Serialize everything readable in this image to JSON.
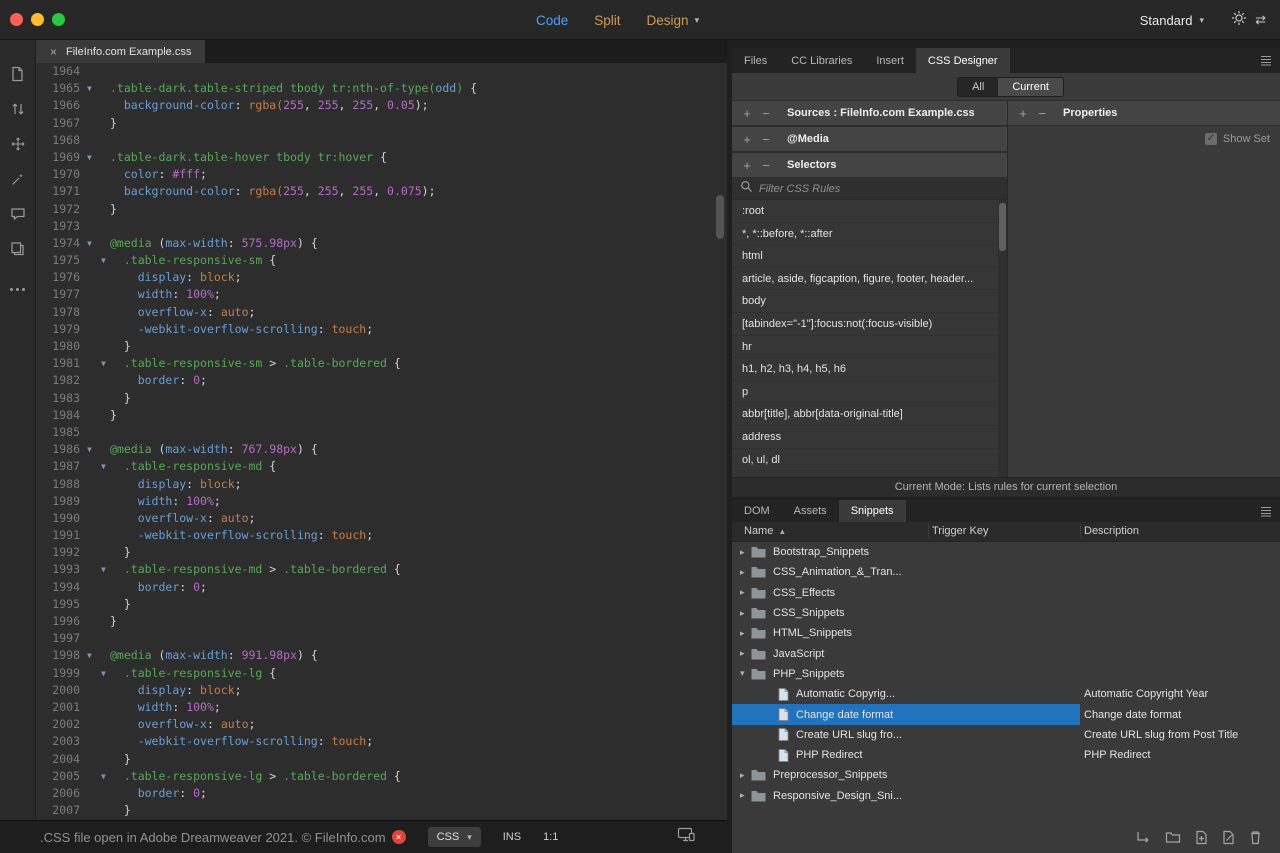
{
  "topbar": {
    "view_modes": [
      {
        "label": "Code",
        "active": true
      },
      {
        "label": "Split",
        "active": false
      },
      {
        "label": "Design",
        "active": false
      }
    ],
    "workspace": {
      "label": "Standard"
    }
  },
  "editor": {
    "tab": {
      "title": "FileInfo.com Example.css",
      "close_glyph": "×"
    },
    "status": {
      "message": ".CSS file open in Adobe Dreamweaver 2021. © FileInfo.com",
      "doc_type": "CSS",
      "insert_mode": "INS",
      "cursor_position": "1:1"
    },
    "lines": [
      {
        "n": 1964,
        "f": 0,
        "k": []
      },
      {
        "n": 1965,
        "f": 1,
        "k": [
          [
            ".table-dark.table-striped tbody tr:nth-of-type(",
            "s"
          ],
          [
            "odd",
            "p"
          ],
          [
            ")",
            "s"
          ],
          [
            " {",
            "w"
          ]
        ]
      },
      {
        "n": 1966,
        "f": 0,
        "k": [
          [
            "  ",
            "w"
          ],
          [
            "background-color",
            "p"
          ],
          [
            ": ",
            "w"
          ],
          [
            "rgba(",
            "v"
          ],
          [
            "255",
            "n"
          ],
          [
            ", ",
            "w"
          ],
          [
            "255",
            "n"
          ],
          [
            ", ",
            "w"
          ],
          [
            "255",
            "n"
          ],
          [
            ", ",
            "w"
          ],
          [
            "0.05",
            "n"
          ],
          [
            ");",
            "w"
          ]
        ]
      },
      {
        "n": 1967,
        "f": 0,
        "k": [
          [
            "}",
            "w"
          ]
        ]
      },
      {
        "n": 1968,
        "f": 0,
        "k": []
      },
      {
        "n": 1969,
        "f": 1,
        "k": [
          [
            ".table-dark.table-hover tbody tr:hover",
            "s"
          ],
          [
            " {",
            "w"
          ]
        ]
      },
      {
        "n": 1970,
        "f": 0,
        "k": [
          [
            "  ",
            "w"
          ],
          [
            "color",
            "p"
          ],
          [
            ": ",
            "w"
          ],
          [
            "#fff",
            "n"
          ],
          [
            ";",
            "w"
          ]
        ]
      },
      {
        "n": 1971,
        "f": 0,
        "k": [
          [
            "  ",
            "w"
          ],
          [
            "background-color",
            "p"
          ],
          [
            ": ",
            "w"
          ],
          [
            "rgba(",
            "v"
          ],
          [
            "255",
            "n"
          ],
          [
            ", ",
            "w"
          ],
          [
            "255",
            "n"
          ],
          [
            ", ",
            "w"
          ],
          [
            "255",
            "n"
          ],
          [
            ", ",
            "w"
          ],
          [
            "0.075",
            "n"
          ],
          [
            ");",
            "w"
          ]
        ]
      },
      {
        "n": 1972,
        "f": 0,
        "k": [
          [
            "}",
            "w"
          ]
        ]
      },
      {
        "n": 1973,
        "f": 0,
        "k": []
      },
      {
        "n": 1974,
        "f": 1,
        "k": [
          [
            "@media ",
            "s"
          ],
          [
            "(",
            "w"
          ],
          [
            "max-width",
            "p"
          ],
          [
            ": ",
            "w"
          ],
          [
            "575.98px",
            "n"
          ],
          [
            ") {",
            "w"
          ]
        ]
      },
      {
        "n": 1975,
        "f": 1,
        "k": [
          [
            "  ",
            "w"
          ],
          [
            ".table-responsive-sm",
            "s"
          ],
          [
            " {",
            "w"
          ]
        ]
      },
      {
        "n": 1976,
        "f": 0,
        "k": [
          [
            "    ",
            "w"
          ],
          [
            "display",
            "p"
          ],
          [
            ": ",
            "w"
          ],
          [
            "block",
            "v"
          ],
          [
            ";",
            "w"
          ]
        ]
      },
      {
        "n": 1977,
        "f": 0,
        "k": [
          [
            "    ",
            "w"
          ],
          [
            "width",
            "p"
          ],
          [
            ": ",
            "w"
          ],
          [
            "100%",
            "n"
          ],
          [
            ";",
            "w"
          ]
        ]
      },
      {
        "n": 1978,
        "f": 0,
        "k": [
          [
            "    ",
            "w"
          ],
          [
            "overflow-x",
            "p"
          ],
          [
            ": ",
            "w"
          ],
          [
            "auto",
            "v"
          ],
          [
            ";",
            "w"
          ]
        ]
      },
      {
        "n": 1979,
        "f": 0,
        "k": [
          [
            "    ",
            "w"
          ],
          [
            "-webkit-overflow-scrolling",
            "p"
          ],
          [
            ": ",
            "w"
          ],
          [
            "touch",
            "v"
          ],
          [
            ";",
            "w"
          ]
        ]
      },
      {
        "n": 1980,
        "f": 0,
        "k": [
          [
            "  }",
            "w"
          ]
        ]
      },
      {
        "n": 1981,
        "f": 1,
        "k": [
          [
            "  ",
            "w"
          ],
          [
            ".table-responsive-sm ",
            "s"
          ],
          [
            "> ",
            "w"
          ],
          [
            ".table-bordered",
            "s"
          ],
          [
            " {",
            "w"
          ]
        ]
      },
      {
        "n": 1982,
        "f": 0,
        "k": [
          [
            "    ",
            "w"
          ],
          [
            "border",
            "p"
          ],
          [
            ": ",
            "w"
          ],
          [
            "0",
            "n"
          ],
          [
            ";",
            "w"
          ]
        ]
      },
      {
        "n": 1983,
        "f": 0,
        "k": [
          [
            "  }",
            "w"
          ]
        ]
      },
      {
        "n": 1984,
        "f": 0,
        "k": [
          [
            "}",
            "w"
          ]
        ]
      },
      {
        "n": 1985,
        "f": 0,
        "k": []
      },
      {
        "n": 1986,
        "f": 1,
        "k": [
          [
            "@media ",
            "s"
          ],
          [
            "(",
            "w"
          ],
          [
            "max-width",
            "p"
          ],
          [
            ": ",
            "w"
          ],
          [
            "767.98px",
            "n"
          ],
          [
            ") {",
            "w"
          ]
        ]
      },
      {
        "n": 1987,
        "f": 1,
        "k": [
          [
            "  ",
            "w"
          ],
          [
            ".table-responsive-md",
            "s"
          ],
          [
            " {",
            "w"
          ]
        ]
      },
      {
        "n": 1988,
        "f": 0,
        "k": [
          [
            "    ",
            "w"
          ],
          [
            "display",
            "p"
          ],
          [
            ": ",
            "w"
          ],
          [
            "block",
            "v"
          ],
          [
            ";",
            "w"
          ]
        ]
      },
      {
        "n": 1989,
        "f": 0,
        "k": [
          [
            "    ",
            "w"
          ],
          [
            "width",
            "p"
          ],
          [
            ": ",
            "w"
          ],
          [
            "100%",
            "n"
          ],
          [
            ";",
            "w"
          ]
        ]
      },
      {
        "n": 1990,
        "f": 0,
        "k": [
          [
            "    ",
            "w"
          ],
          [
            "overflow-x",
            "p"
          ],
          [
            ": ",
            "w"
          ],
          [
            "auto",
            "v"
          ],
          [
            ";",
            "w"
          ]
        ]
      },
      {
        "n": 1991,
        "f": 0,
        "k": [
          [
            "    ",
            "w"
          ],
          [
            "-webkit-overflow-scrolling",
            "p"
          ],
          [
            ": ",
            "w"
          ],
          [
            "touch",
            "v"
          ],
          [
            ";",
            "w"
          ]
        ]
      },
      {
        "n": 1992,
        "f": 0,
        "k": [
          [
            "  }",
            "w"
          ]
        ]
      },
      {
        "n": 1993,
        "f": 1,
        "k": [
          [
            "  ",
            "w"
          ],
          [
            ".table-responsive-md ",
            "s"
          ],
          [
            "> ",
            "w"
          ],
          [
            ".table-bordered",
            "s"
          ],
          [
            " {",
            "w"
          ]
        ]
      },
      {
        "n": 1994,
        "f": 0,
        "k": [
          [
            "    ",
            "w"
          ],
          [
            "border",
            "p"
          ],
          [
            ": ",
            "w"
          ],
          [
            "0",
            "n"
          ],
          [
            ";",
            "w"
          ]
        ]
      },
      {
        "n": 1995,
        "f": 0,
        "k": [
          [
            "  }",
            "w"
          ]
        ]
      },
      {
        "n": 1996,
        "f": 0,
        "k": [
          [
            "}",
            "w"
          ]
        ]
      },
      {
        "n": 1997,
        "f": 0,
        "k": []
      },
      {
        "n": 1998,
        "f": 1,
        "k": [
          [
            "@media ",
            "s"
          ],
          [
            "(",
            "w"
          ],
          [
            "max-width",
            "p"
          ],
          [
            ": ",
            "w"
          ],
          [
            "991.98px",
            "n"
          ],
          [
            ") {",
            "w"
          ]
        ]
      },
      {
        "n": 1999,
        "f": 1,
        "k": [
          [
            "  ",
            "w"
          ],
          [
            ".table-responsive-lg",
            "s"
          ],
          [
            " {",
            "w"
          ]
        ]
      },
      {
        "n": 2000,
        "f": 0,
        "k": [
          [
            "    ",
            "w"
          ],
          [
            "display",
            "p"
          ],
          [
            ": ",
            "w"
          ],
          [
            "block",
            "v"
          ],
          [
            ";",
            "w"
          ]
        ]
      },
      {
        "n": 2001,
        "f": 0,
        "k": [
          [
            "    ",
            "w"
          ],
          [
            "width",
            "p"
          ],
          [
            ": ",
            "w"
          ],
          [
            "100%",
            "n"
          ],
          [
            ";",
            "w"
          ]
        ]
      },
      {
        "n": 2002,
        "f": 0,
        "k": [
          [
            "    ",
            "w"
          ],
          [
            "overflow-x",
            "p"
          ],
          [
            ": ",
            "w"
          ],
          [
            "auto",
            "v"
          ],
          [
            ";",
            "w"
          ]
        ]
      },
      {
        "n": 2003,
        "f": 0,
        "k": [
          [
            "    ",
            "w"
          ],
          [
            "-webkit-overflow-scrolling",
            "p"
          ],
          [
            ": ",
            "w"
          ],
          [
            "touch",
            "v"
          ],
          [
            ";",
            "w"
          ]
        ]
      },
      {
        "n": 2004,
        "f": 0,
        "k": [
          [
            "  }",
            "w"
          ]
        ]
      },
      {
        "n": 2005,
        "f": 1,
        "k": [
          [
            "  ",
            "w"
          ],
          [
            ".table-responsive-lg ",
            "s"
          ],
          [
            "> ",
            "w"
          ],
          [
            ".table-bordered",
            "s"
          ],
          [
            " {",
            "w"
          ]
        ]
      },
      {
        "n": 2006,
        "f": 0,
        "k": [
          [
            "    ",
            "w"
          ],
          [
            "border",
            "p"
          ],
          [
            ": ",
            "w"
          ],
          [
            "0",
            "n"
          ],
          [
            ";",
            "w"
          ]
        ]
      },
      {
        "n": 2007,
        "f": 0,
        "k": [
          [
            "  }",
            "w"
          ]
        ]
      }
    ]
  },
  "css_designer": {
    "tabs": [
      {
        "label": "Files"
      },
      {
        "label": "CC Libraries"
      },
      {
        "label": "Insert"
      },
      {
        "label": "CSS Designer",
        "active": true
      }
    ],
    "mode_toggle": [
      {
        "label": "All",
        "active": false
      },
      {
        "label": "Current",
        "active": true
      }
    ],
    "sources_header": {
      "label": "Sources : FileInfo.com Example.css"
    },
    "media_header": {
      "label": "@Media"
    },
    "selectors_header": {
      "label": "Selectors"
    },
    "filter_placeholder": "Filter CSS Rules",
    "selectors": [
      ":root",
      "*, *::before, *::after",
      "html",
      "article, aside, figcaption, figure, footer, header...",
      "body",
      "[tabindex=\"-1\"]:focus:not(:focus-visible)",
      "hr",
      "h1, h2, h3, h4, h5, h6",
      "p",
      "abbr[title], abbr[data-original-title]",
      "address",
      "ol, ul, dl"
    ],
    "properties_header": {
      "label": "Properties",
      "show_set": "Show Set",
      "show_set_checked": true
    },
    "mode_status": "Current Mode: Lists rules for current selection"
  },
  "snippets_panel": {
    "tabs": [
      {
        "label": "DOM"
      },
      {
        "label": "Assets"
      },
      {
        "label": "Snippets",
        "active": true
      }
    ],
    "columns": {
      "name": "Name",
      "trigger": "Trigger Key",
      "description": "Description"
    },
    "tree": [
      {
        "type": "folder",
        "label": "Bootstrap_Snippets",
        "expanded": false
      },
      {
        "type": "folder",
        "label": "CSS_Animation_&_Tran...",
        "expanded": false
      },
      {
        "type": "folder",
        "label": "CSS_Effects",
        "expanded": false
      },
      {
        "type": "folder",
        "label": "CSS_Snippets",
        "expanded": false
      },
      {
        "type": "folder",
        "label": "HTML_Snippets",
        "expanded": false
      },
      {
        "type": "folder",
        "label": "JavaScript",
        "expanded": false
      },
      {
        "type": "folder",
        "label": "PHP_Snippets",
        "expanded": true,
        "children": [
          {
            "name": "Automatic Copyrig...",
            "description": "Automatic Copyright Year",
            "selected": false
          },
          {
            "name": "Change date format",
            "description": "Change date format",
            "selected": true
          },
          {
            "name": "Create URL slug fro...",
            "description": "Create URL slug from Post Title",
            "selected": false
          },
          {
            "name": "PHP Redirect",
            "description": "PHP Redirect",
            "selected": false
          }
        ]
      },
      {
        "type": "folder",
        "label": "Preprocessor_Snippets",
        "expanded": false
      },
      {
        "type": "folder",
        "label": "Responsive_Design_Sni...",
        "expanded": false
      }
    ]
  },
  "colors": {
    "selection_blue": "#2273bd",
    "view_mode_active_blue": "#4ba0f7",
    "view_mode_inactive_amber": "#cf9b52",
    "code_selector_green": "#58a758",
    "code_property_blue": "#6a9ed6",
    "code_value_orange": "#c57e4a",
    "code_number_purple": "#b66bc8",
    "error_red": "#e0443a"
  }
}
